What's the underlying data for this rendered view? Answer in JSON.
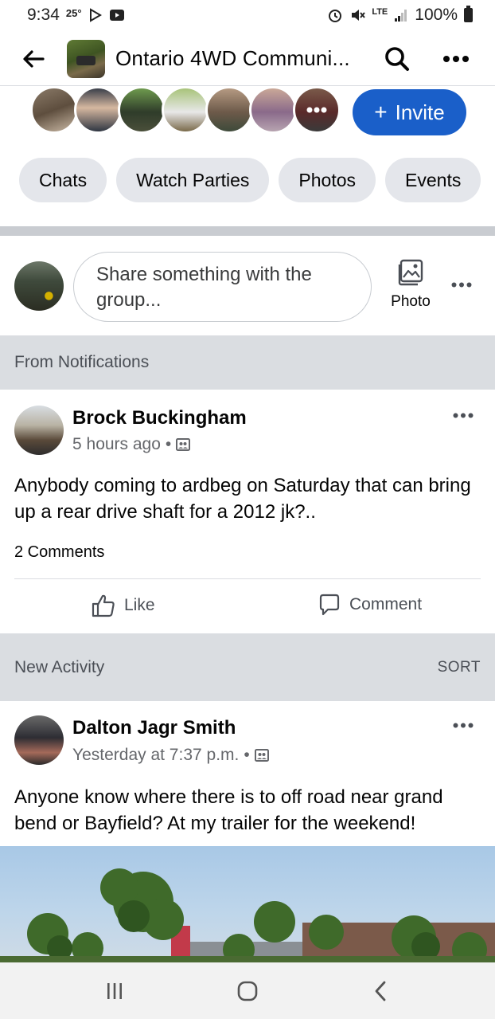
{
  "status_bar": {
    "time": "9:34",
    "temperature": "25°",
    "network": "LTE",
    "battery": "100%"
  },
  "header": {
    "back_icon": "arrow-left-icon",
    "group_title": "Ontario 4WD Communi...",
    "search_icon": "search-icon",
    "more_icon": "more-horizontal-icon"
  },
  "members": {
    "invite_label": "Invite",
    "invite_icon": "plus-icon"
  },
  "chips": [
    {
      "label": "Chats"
    },
    {
      "label": "Watch Parties"
    },
    {
      "label": "Photos"
    },
    {
      "label": "Events"
    }
  ],
  "composer": {
    "placeholder": "Share something with the group...",
    "photo_label": "Photo"
  },
  "sections": {
    "notifications": "From Notifications",
    "new_activity": "New Activity",
    "sort_label": "SORT"
  },
  "posts": [
    {
      "author": "Brock Buckingham",
      "time": "5 hours ago",
      "text": "Anybody coming to ardbeg on Saturday  that can bring up a rear drive shaft for a 2012 jk?..",
      "comments": "2 Comments",
      "like_label": "Like",
      "comment_label": "Comment"
    },
    {
      "author": "Dalton Jagr Smith",
      "time": "Yesterday at 7:37 p.m.",
      "text": "Anyone know where there is to off road near grand bend or Bayfield? At my trailer for the weekend!"
    }
  ],
  "colors": {
    "accent": "#1a5fc9",
    "chip_bg": "#e4e6eb",
    "section_bg": "#dadde1",
    "secondary_text": "#65676b"
  }
}
